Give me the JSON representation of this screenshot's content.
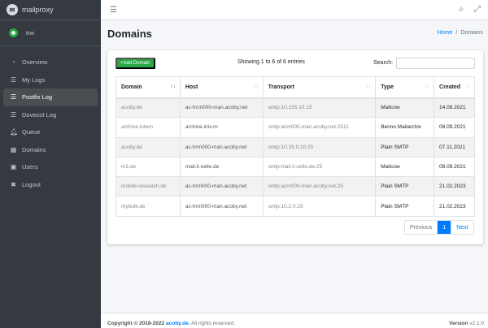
{
  "brand": {
    "name": "mailproxy",
    "logo_icon": "envelope-icon"
  },
  "user": {
    "name": "trw"
  },
  "sidebar": {
    "items": [
      {
        "label": "Overview",
        "icon": "dashboard-icon"
      },
      {
        "label": "My Logs",
        "icon": "list-icon"
      },
      {
        "label": "Postfix Log",
        "icon": "list-icon",
        "active": true
      },
      {
        "label": "Dovecot Log",
        "icon": "list-icon"
      },
      {
        "label": "Queue",
        "icon": "bell-icon"
      },
      {
        "label": "Domains",
        "icon": "calendar-icon"
      },
      {
        "label": "Users",
        "icon": "address-book-icon"
      },
      {
        "label": "Logout",
        "icon": "logout-icon"
      }
    ]
  },
  "header": {
    "title": "Domains",
    "breadcrumb": {
      "home": "Home",
      "sep": "/",
      "current": "Domains"
    }
  },
  "card": {
    "add_button": "+Add Domain",
    "info": "Showing 1 to 6 of 6 entries",
    "search_label": "Search:",
    "search_value": ""
  },
  "table": {
    "columns": [
      "Domain",
      "Host",
      "Transport",
      "Type",
      "Created"
    ],
    "rows": [
      [
        "acoby.de",
        "ac-hcm000-man.acoby.net",
        "smtp:10.155.10.15",
        "Mailcow",
        "14.09.2021"
      ],
      [
        "archive.intern",
        "archive.inix.rn",
        "smtp:acm000-man.acoby.net:2511",
        "Benno Mailarchiv",
        "08.09.2021"
      ],
      [
        "acoby.de",
        "ac-hrm000-man.acoby.net",
        "smtp:10.15.0.10:25",
        "Plain SMTP",
        "07.11.2021"
      ],
      [
        "m3.de",
        "mail.li-oelle.de",
        "smtp:mail.li-oelle.de:25",
        "Mailcow",
        "08.09.2021"
      ],
      [
        "mobile-research.de",
        "ac-hrm000-man.acoby.net",
        "smtp:acm000-man.acoby.net:25",
        "Plain SMTP",
        "21.02.2023"
      ],
      [
        "mybulk.de",
        "ac-hrm000-man.acoby.net",
        "smtp:10.2.0.15",
        "Plain SMTP",
        "21.02.2023"
      ]
    ]
  },
  "pagination": {
    "previous": "Previous",
    "current": "1",
    "next": "Next"
  },
  "footer": {
    "copyright": "Copyright © 2018-2022",
    "company": "acoby.de.",
    "rights": "All rights reserved.",
    "version_label": "Version",
    "version": "v2.1.0"
  },
  "colors": {
    "sidebar": "#343a40",
    "accent": "#007bff",
    "success": "#28a745"
  }
}
